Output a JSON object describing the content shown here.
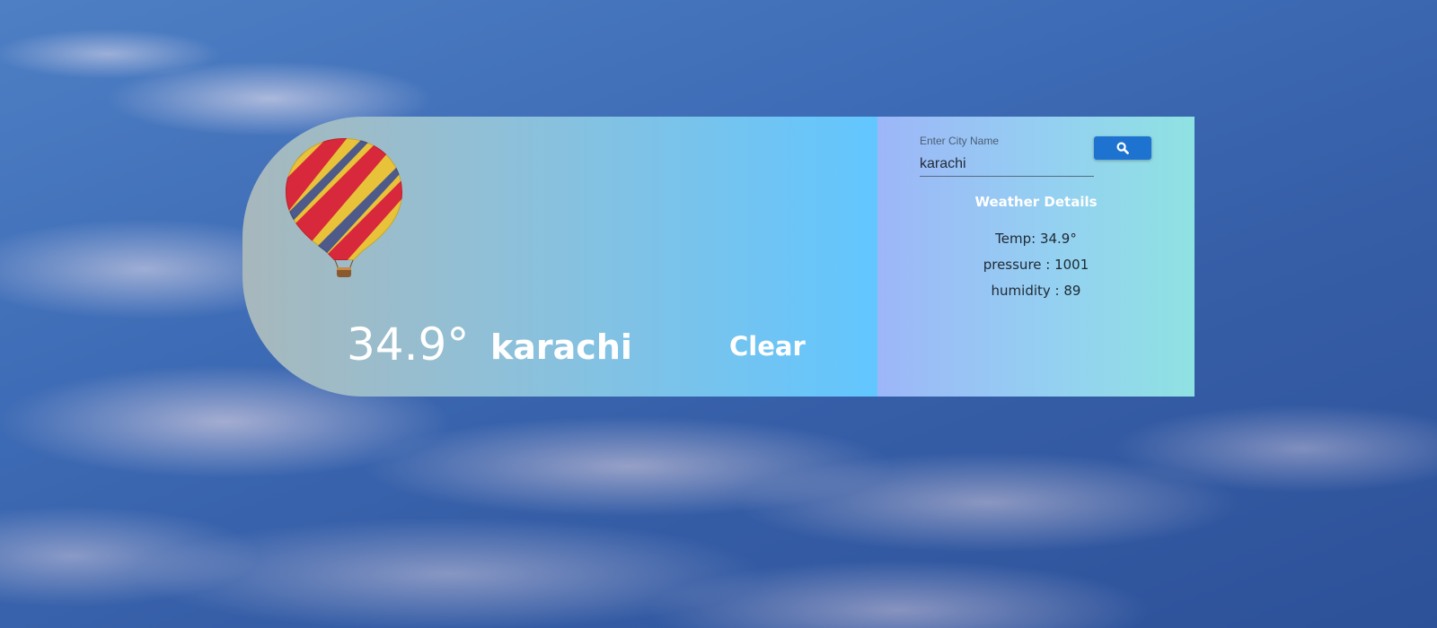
{
  "hero": {
    "temperature": "34.9°",
    "city": "karachi",
    "condition": "Clear",
    "image": "hot-air-balloon"
  },
  "search": {
    "label": "Enter City Name",
    "value": "karachi",
    "button_icon": "search-icon"
  },
  "details": {
    "title": "Weather Details",
    "temp": "Temp: 34.9°",
    "pressure": "pressure : 1001",
    "humidity": "humidity : 89"
  },
  "colors": {
    "button": "#1e73d0",
    "hero_gradient_start": "#a7b8bc",
    "hero_gradient_end": "#62c6ff",
    "side_gradient_start": "#9db6f8",
    "side_gradient_end": "#8fe2e2",
    "sky": "#3e6cb6"
  }
}
